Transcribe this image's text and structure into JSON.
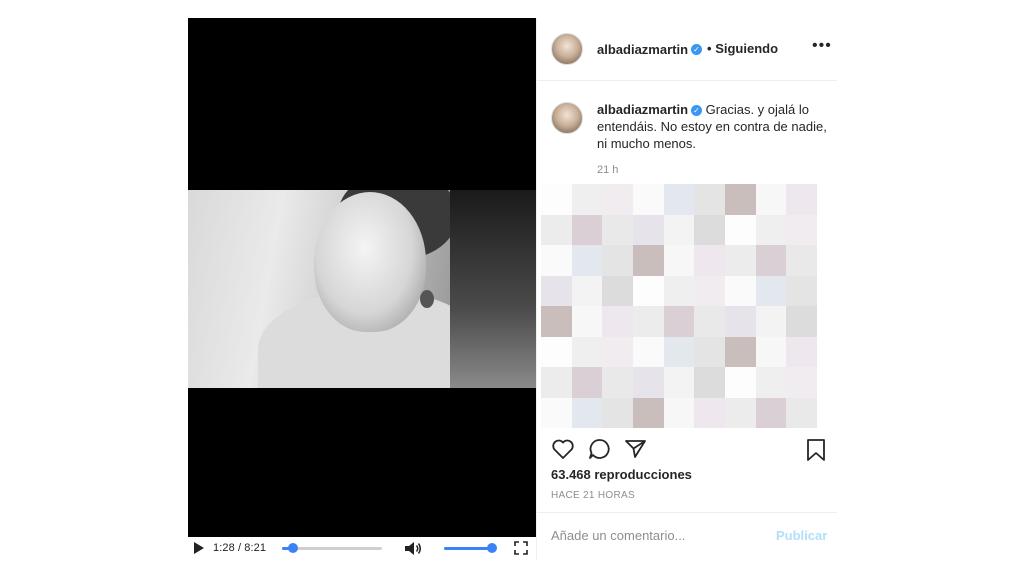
{
  "video": {
    "time": "1:28 / 8:21",
    "progress_fraction": 0.11,
    "volume_fraction": 0.95
  },
  "header": {
    "username": "albadiazmartin",
    "separator": "•",
    "follow_status": "Siguiendo",
    "more_icon": "more-horizontal-icon"
  },
  "comment": {
    "username": "albadiazmartin",
    "text": "Gracias. y ojalá lo entendáis. No estoy en contra de nadie, ni mucho menos.",
    "time": "21 h"
  },
  "actions": {
    "like_icon": "heart-icon",
    "comment_icon": "comment-icon",
    "share_icon": "share-icon",
    "save_icon": "bookmark-icon"
  },
  "views": "63.468 reproducciones",
  "posted": "HACE 21 HORAS",
  "add_comment": {
    "placeholder": "Añade un comentario...",
    "publish_label": "Publicar"
  },
  "colors": {
    "verified": "#3897f0",
    "accent": "#3b82f6",
    "publish_disabled": "#b2dffc"
  }
}
